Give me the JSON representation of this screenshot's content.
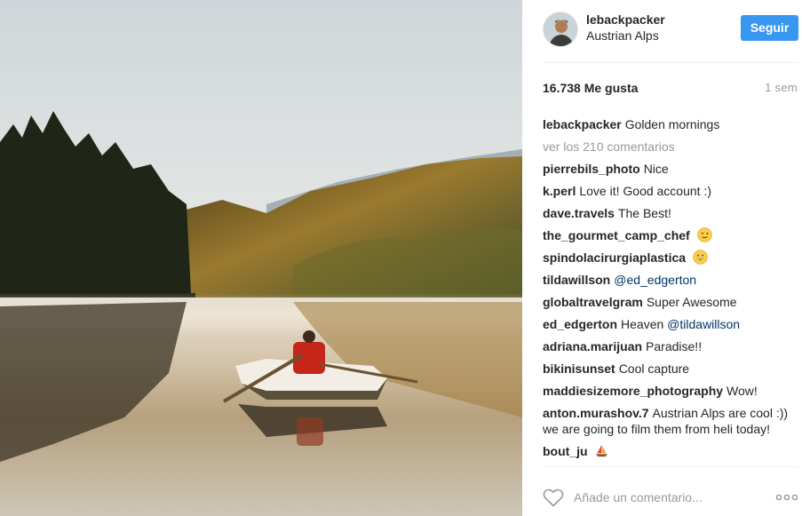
{
  "post": {
    "username": "lebackpacker",
    "location": "Austrian Alps",
    "follow_label": "Seguir",
    "likes": "16.738 Me gusta",
    "time_ago": "1 sem",
    "photo_description_icon": "lake-rowboat-photo",
    "caption_user": "lebackpacker",
    "caption_text": "Golden mornings",
    "view_all_comments": "ver los 210 comentarios",
    "add_comment_placeholder": "Añade un comentario...",
    "more_options": "ooo"
  },
  "comments": [
    {
      "user": "pierrebils_photo",
      "text": "Nice"
    },
    {
      "user": "k.perl",
      "text": "Love it! Good account :)"
    },
    {
      "user": "dave.travels",
      "text": "The Best!"
    },
    {
      "user": "the_gourmet_camp_chef",
      "text": "",
      "emoji": "winking-face-emoji"
    },
    {
      "user": "spindolacirurgiaplastica",
      "text": "",
      "emoji": "grinning-face-emoji"
    },
    {
      "user": "tildawillson",
      "text": "",
      "mention": "@ed_edgerton"
    },
    {
      "user": "globaltravelgram",
      "text": "Super Awesome"
    },
    {
      "user": "ed_edgerton",
      "text": "Heaven",
      "mention": "@tildawillson"
    },
    {
      "user": "adriana.marijuan",
      "text": "Paradise!!"
    },
    {
      "user": "bikinisunset",
      "text": "Cool capture"
    },
    {
      "user": "maddiesizemore_photography",
      "text": "Wow!"
    },
    {
      "user": "anton.murashov.7",
      "text": "Austrian Alps are cool :)) we are going to film them from heli today!"
    },
    {
      "user": "bout_ju",
      "text": "",
      "emoji": "sailboat-emoji"
    }
  ],
  "colors": {
    "follow_button": "#3897f0",
    "mention": "#003569",
    "muted_text": "#999999",
    "divider": "#efefef"
  }
}
